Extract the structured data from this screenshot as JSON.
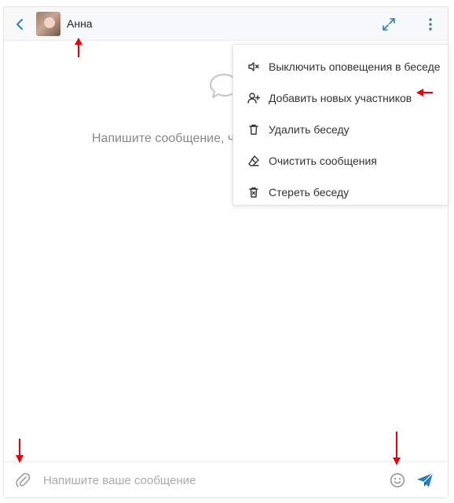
{
  "header": {
    "contact_name": "Анна",
    "back_icon": "chevron-left-icon",
    "expand_icon": "expand-icon",
    "more_icon": "more-vertical-icon"
  },
  "empty_state": {
    "icon": "chat-bubbles-icon",
    "text": "Напишите сообщение, ч"
  },
  "menu": {
    "items": [
      {
        "label": "Выключить оповещения в беседе",
        "icon": "mute-icon"
      },
      {
        "label": "Добавить новых участников",
        "icon": "add-user-icon"
      },
      {
        "label": "Удалить беседу",
        "icon": "trash-icon"
      },
      {
        "label": "Очистить сообщения",
        "icon": "eraser-icon"
      },
      {
        "label": "Стереть беседу",
        "icon": "trash-x-icon"
      }
    ]
  },
  "composer": {
    "placeholder": "Напишите ваше сообщение",
    "attach_icon": "paperclip-icon",
    "emoji_icon": "smiley-icon",
    "send_icon": "send-icon"
  },
  "colors": {
    "accent": "#2a7fb8",
    "annotation_arrow": "#e8000b",
    "header_bg": "#f7f8fa"
  }
}
